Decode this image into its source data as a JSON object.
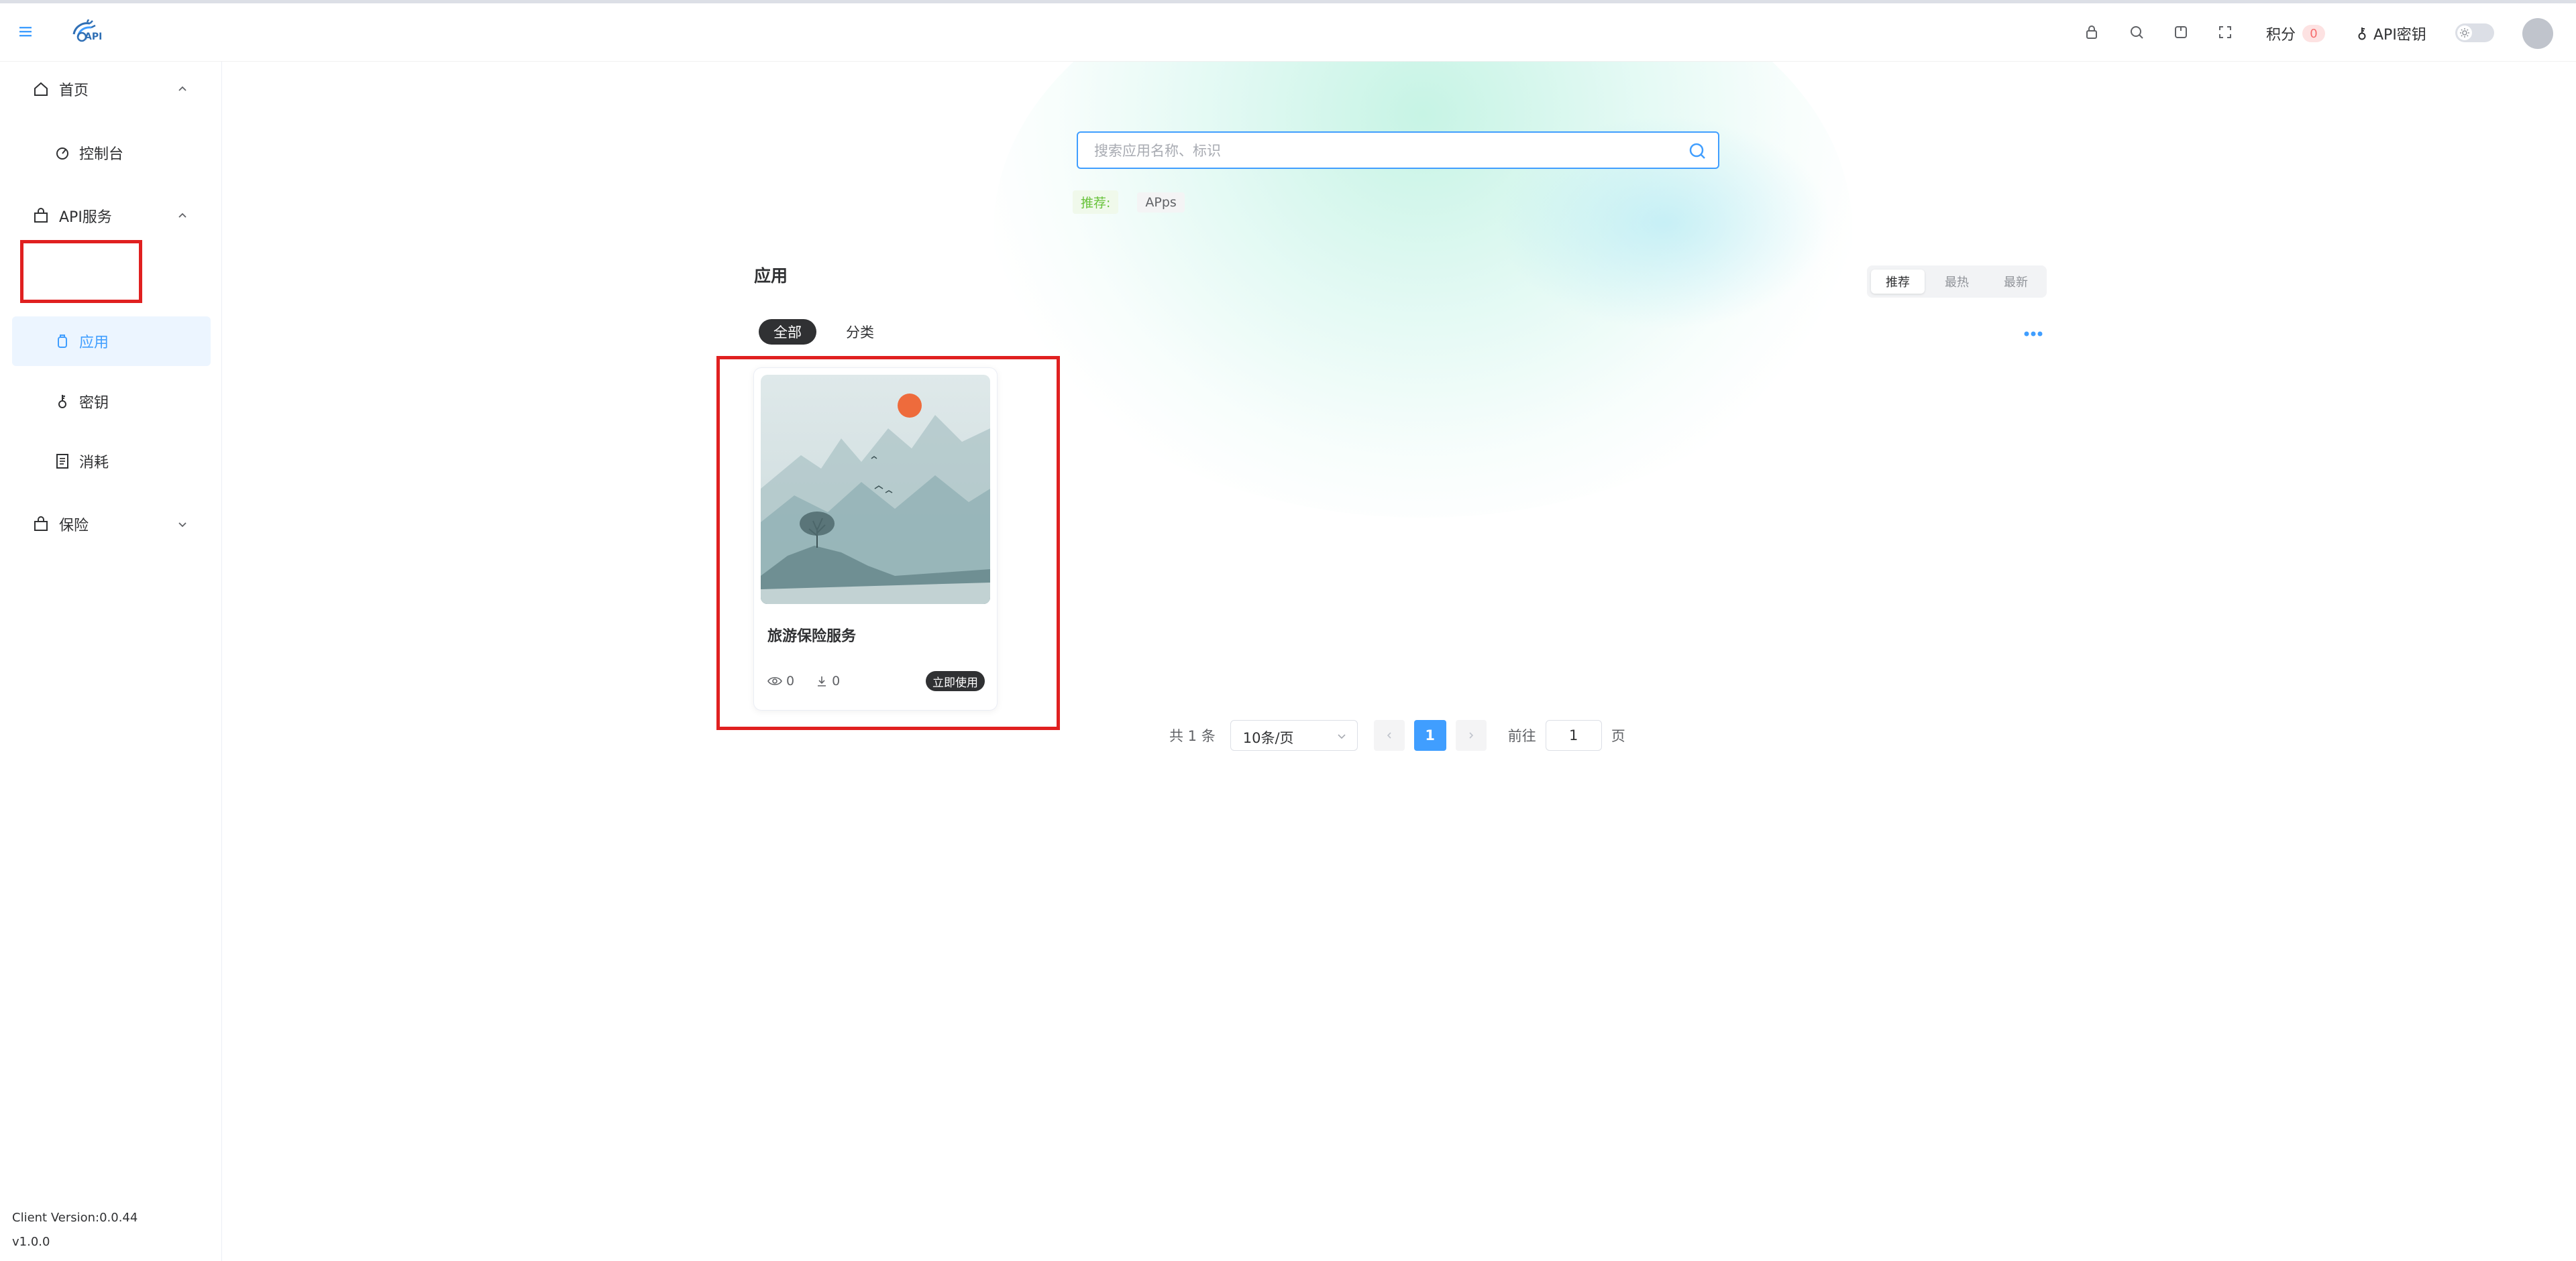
{
  "header": {
    "logo_text": "API",
    "points_label": "积分",
    "points_value": "0",
    "api_key_label": "API密钥"
  },
  "sidebar": {
    "items": [
      {
        "label": "首页",
        "icon": "home-icon",
        "type": "group",
        "expanded": true
      },
      {
        "label": "控制台",
        "icon": "dashboard-icon",
        "type": "item"
      },
      {
        "label": "API服务",
        "icon": "bag-icon",
        "type": "group",
        "expanded": true
      },
      {
        "label": "应用",
        "icon": "app-icon",
        "type": "item",
        "active": true
      },
      {
        "label": "密钥",
        "icon": "key-icon",
        "type": "item"
      },
      {
        "label": "消耗",
        "icon": "document-icon",
        "type": "item"
      },
      {
        "label": "保险",
        "icon": "bag-icon",
        "type": "group",
        "expanded": false
      }
    ],
    "client_version": "Client Version:0.0.44",
    "version": "v1.0.0"
  },
  "search": {
    "placeholder": "搜索应用名称、标识"
  },
  "recommend": {
    "label": "推荐:",
    "tags": [
      "APps"
    ]
  },
  "section": {
    "title": "应用",
    "sort_options": [
      "推荐",
      "最热",
      "最新"
    ],
    "active_sort": "推荐",
    "tabs": [
      "全部",
      "分类"
    ],
    "active_tab": "全部"
  },
  "cards": [
    {
      "title": "旅游保险服务",
      "views": "0",
      "downloads": "0",
      "button_label": "立即使用"
    }
  ],
  "pagination": {
    "total_text": "共 1 条",
    "page_size": "10条/页",
    "current_page": "1",
    "goto_label": "前往",
    "goto_value": "1",
    "page_unit": "页"
  },
  "colors": {
    "accent": "#409eff",
    "active_bg": "#ecf5ff",
    "highlight": "#e02020",
    "dark": "#303133"
  }
}
